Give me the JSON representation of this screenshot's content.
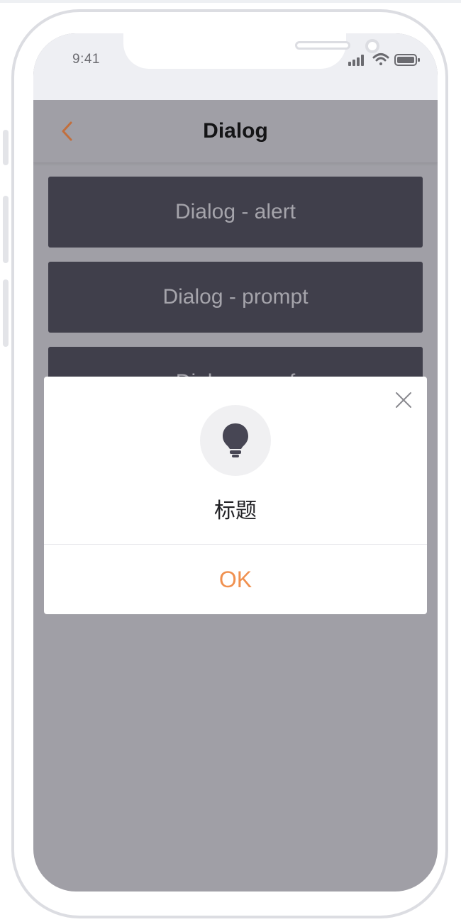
{
  "status_bar": {
    "time": "9:41",
    "icons": [
      "signal-icon",
      "wifi-icon",
      "battery-icon"
    ]
  },
  "nav": {
    "title": "Dialog",
    "back_icon": "chevron-left-icon"
  },
  "buttons": [
    {
      "label": "Dialog - alert"
    },
    {
      "label": "Dialog - prompt"
    },
    {
      "label": "Dialog - conf"
    }
  ],
  "dialog": {
    "icon": "lightbulb-icon",
    "title": "标题",
    "ok_label": "OK",
    "close_icon": "close-icon"
  },
  "colors": {
    "accent": "#f0904f",
    "overlay": "#a09fa6",
    "button_bg": "#403f4b",
    "back_arrow": "#c26f3d"
  }
}
